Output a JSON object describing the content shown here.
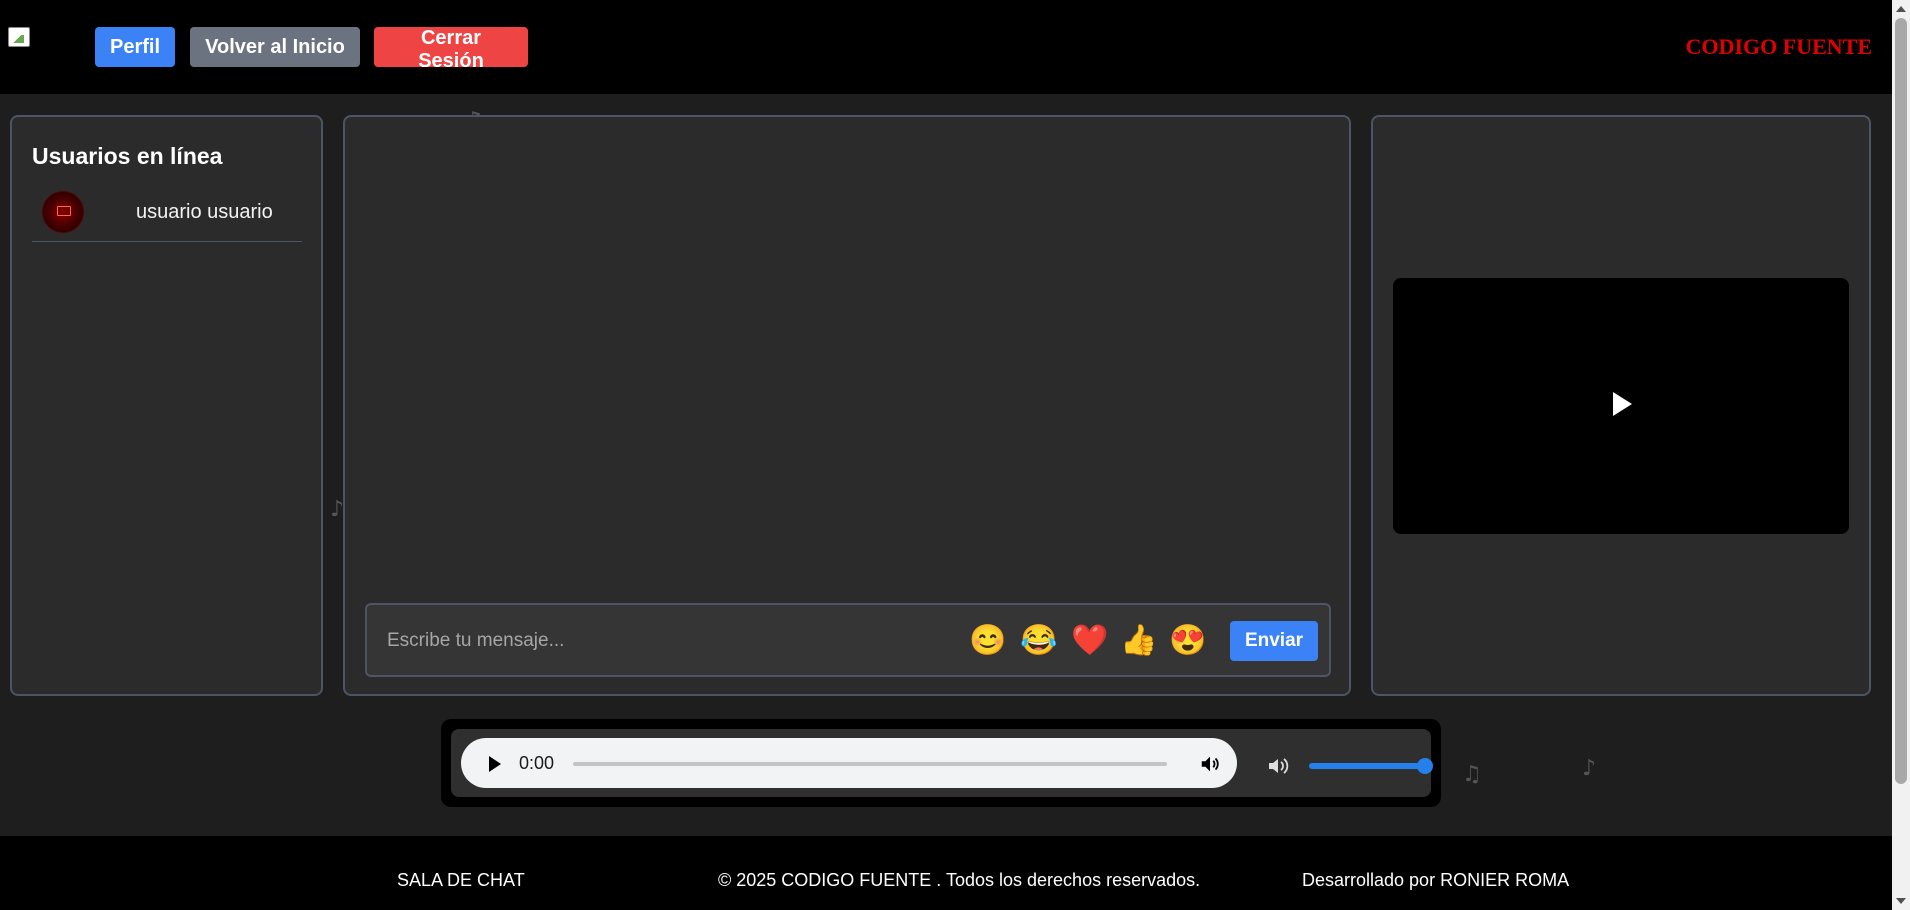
{
  "header": {
    "perfil_label": "Perfil",
    "inicio_label": "Volver al Inicio",
    "salir_label": "Cerrar Sesión",
    "brand": "CODIGO FUENTE"
  },
  "users_panel": {
    "title": "Usuarios en línea",
    "users": [
      {
        "name": "usuario usuario"
      }
    ]
  },
  "chat": {
    "placeholder": "Escribe tu mensaje...",
    "send_label": "Enviar",
    "emojis": [
      "😊",
      "😂",
      "❤️",
      "👍",
      "😍"
    ]
  },
  "audio": {
    "time": "0:00",
    "volume_level": 1.0
  },
  "footer": {
    "left": "SALA DE CHAT",
    "center": "© 2025 CODIGO FUENTE . Todos los derechos reservados.",
    "right": "Desarrollado por RONIER ROMA"
  },
  "decor": {
    "note_glyph": "♪"
  }
}
